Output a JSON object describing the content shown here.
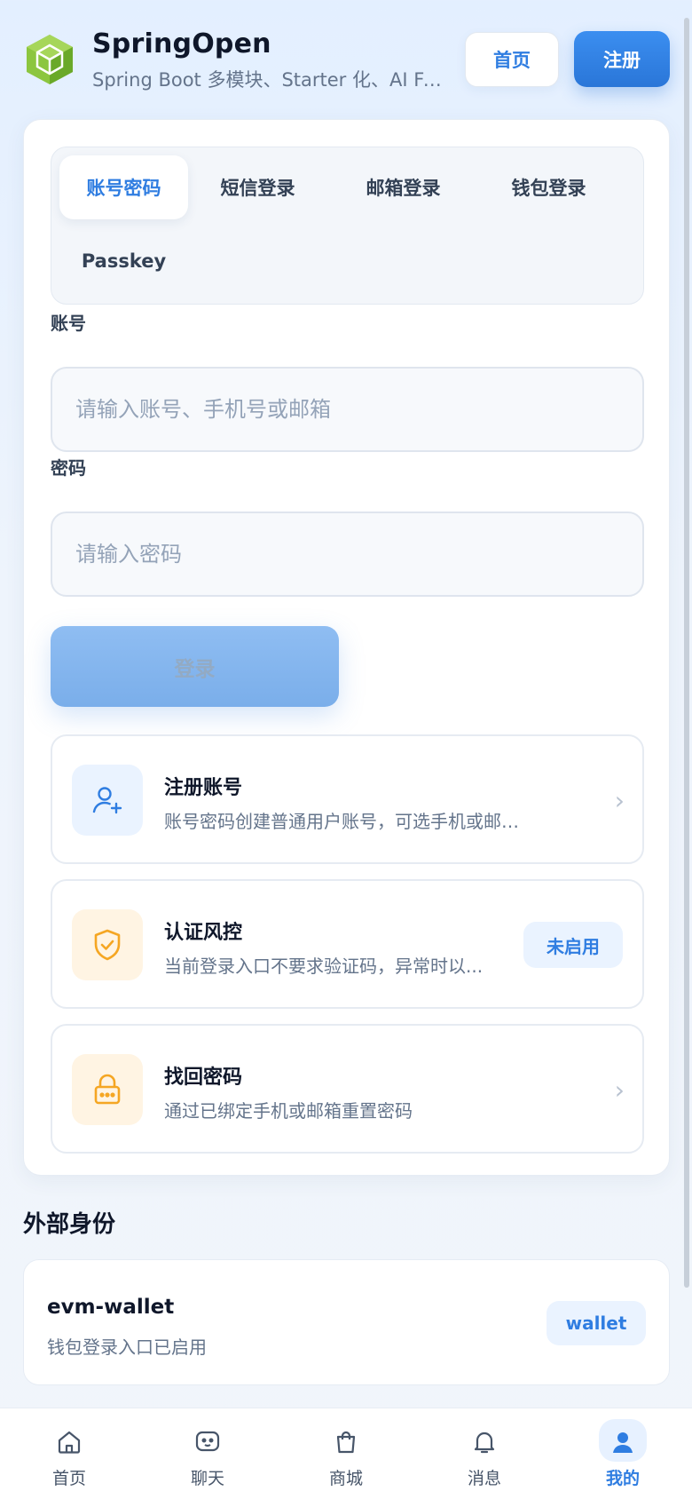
{
  "header": {
    "title": "SpringOpen",
    "subtitle": "Spring Boot 多模块、Starter 化、AI Fri...",
    "home_label": "首页",
    "register_label": "注册",
    "logo_icon": "green-cube-icon"
  },
  "tabs": [
    {
      "label": "账号密码",
      "active": true
    },
    {
      "label": "短信登录"
    },
    {
      "label": "邮箱登录"
    },
    {
      "label": "钱包登录"
    },
    {
      "label": "Passkey"
    }
  ],
  "form": {
    "account_label": "账号",
    "account_placeholder": "请输入账号、手机号或邮箱",
    "password_label": "密码",
    "password_placeholder": "请输入密码",
    "login_label": "登录"
  },
  "items": [
    {
      "title": "注册账号",
      "desc": "账号密码创建普通用户账号，可选手机或邮箱验证",
      "icon": "user-add-icon"
    },
    {
      "title": "认证风控",
      "desc": "当前登录入口不要求验证码，异常时以...",
      "badge": "未启用",
      "icon": "shield-check-icon"
    },
    {
      "title": "找回密码",
      "desc": "通过已绑定手机或邮箱重置密码",
      "icon": "lock-icon"
    }
  ],
  "external": {
    "title": "外部身份",
    "name": "evm-wallet",
    "desc": "钱包登录入口已启用",
    "badge": "wallet"
  },
  "nav": [
    {
      "label": "首页",
      "icon": "home-icon"
    },
    {
      "label": "聊天",
      "icon": "chat-icon"
    },
    {
      "label": "商城",
      "icon": "shopping-bag-icon"
    },
    {
      "label": "消息",
      "icon": "bell-icon"
    },
    {
      "label": "我的",
      "icon": "user-icon",
      "active": true
    }
  ],
  "colors": {
    "accent": "#2f7de1",
    "logo": "#7bc72e",
    "warning": "#f5a623"
  }
}
